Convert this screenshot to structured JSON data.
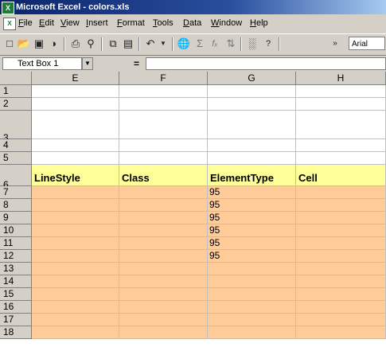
{
  "window": {
    "title": "Microsoft Excel - colors.xls",
    "app_icon": "excel-icon"
  },
  "menu": [
    {
      "key": "F",
      "rest": "ile"
    },
    {
      "key": "E",
      "rest": "dit"
    },
    {
      "key": "V",
      "rest": "iew"
    },
    {
      "key": "I",
      "rest": "nsert"
    },
    {
      "key": "F",
      "rest": "ormat"
    },
    {
      "key": "T",
      "rest": "ools"
    },
    {
      "key": "D",
      "rest": "ata"
    },
    {
      "key": "W",
      "rest": "indow"
    },
    {
      "key": "H",
      "rest": "elp"
    }
  ],
  "toolbar": {
    "font_name": "Arial",
    "buttons": [
      "new-icon",
      "open-icon",
      "save-icon",
      "permission-icon",
      "print-icon",
      "print-preview-icon",
      "copy-icon",
      "paste-icon",
      "undo-icon",
      "dropdown-icon",
      "hyperlink-icon",
      "autosum-icon",
      "function-icon",
      "sort-ascending-icon",
      "chart-wizard-icon",
      "help-icon",
      "toolbar-options-icon"
    ]
  },
  "formula_bar": {
    "name_box": "Text Box 1",
    "equals": "=",
    "formula": ""
  },
  "columns": [
    "E",
    "F",
    "G",
    "H"
  ],
  "rows": [
    "1",
    "2",
    "3",
    "4",
    "5",
    "6",
    "7",
    "8",
    "9",
    "10",
    "11",
    "12",
    "13",
    "14",
    "15",
    "16",
    "17",
    "18"
  ],
  "header_row": {
    "E": "LineStyle",
    "F": "Class",
    "G": "ElementType",
    "H": "Cell"
  },
  "element_type_values": [
    "95",
    "95",
    "95",
    "95",
    "95",
    "95"
  ],
  "colors": {
    "header_fill": "#ffff99",
    "data_fill": "#ffcc99"
  }
}
